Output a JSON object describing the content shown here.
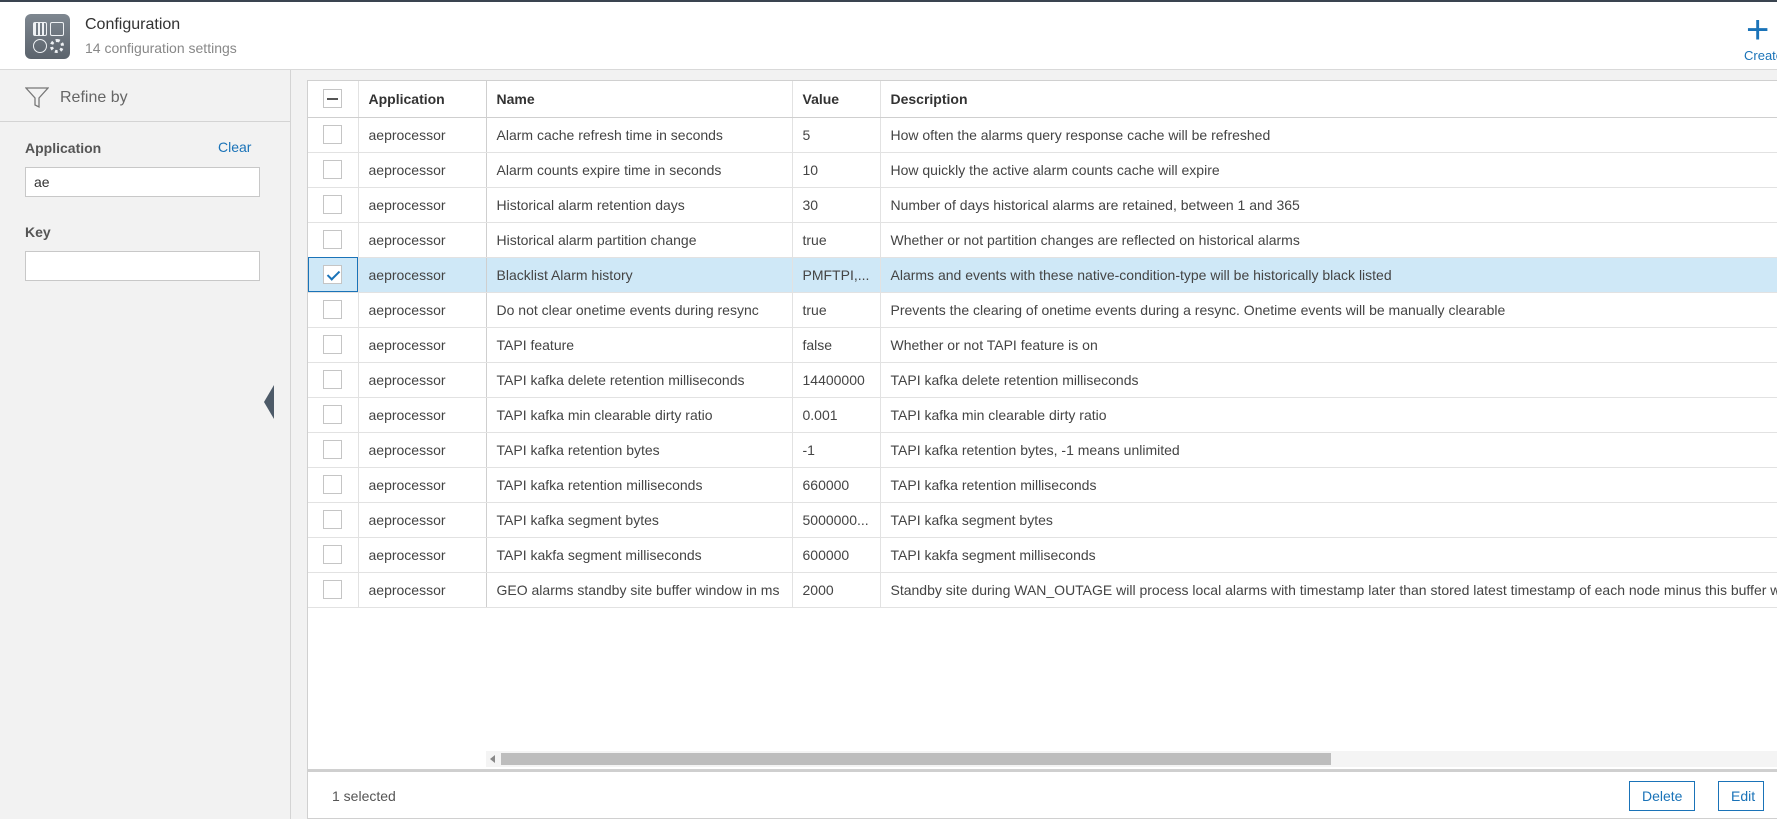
{
  "header": {
    "title": "Configuration",
    "subtitle": "14 configuration settings",
    "create_label": "Create"
  },
  "sidebar": {
    "refine_label": "Refine by",
    "application_label": "Application",
    "clear_label": "Clear",
    "application_value": "ae",
    "key_label": "Key",
    "key_value": ""
  },
  "table": {
    "columns": [
      "Application",
      "Name",
      "Value",
      "Description"
    ],
    "rows": [
      {
        "application": "aeprocessor",
        "name": "Alarm cache refresh time in seconds",
        "value": "5",
        "description": "How often the alarms query response cache will be refreshed",
        "selected": false
      },
      {
        "application": "aeprocessor",
        "name": "Alarm counts expire time in seconds",
        "value": "10",
        "description": "How quickly the active alarm counts cache will expire",
        "selected": false
      },
      {
        "application": "aeprocessor",
        "name": "Historical alarm retention days",
        "value": "30",
        "description": "Number of days historical alarms are retained, between 1 and 365",
        "selected": false
      },
      {
        "application": "aeprocessor",
        "name": "Historical alarm partition change",
        "value": "true",
        "description": "Whether or not partition changes are reflected on historical alarms",
        "selected": false
      },
      {
        "application": "aeprocessor",
        "name": "Blacklist Alarm history",
        "value": "PMFTPI,...",
        "description": "Alarms and events with these native-condition-type will be historically black listed",
        "selected": true
      },
      {
        "application": "aeprocessor",
        "name": "Do not clear onetime events during resync",
        "value": "true",
        "description": "Prevents the clearing of onetime events during a resync. Onetime events will be manually clearable",
        "selected": false
      },
      {
        "application": "aeprocessor",
        "name": "TAPI feature",
        "value": "false",
        "description": "Whether or not TAPI feature is on",
        "selected": false
      },
      {
        "application": "aeprocessor",
        "name": "TAPI kafka delete retention milliseconds",
        "value": "14400000",
        "description": "TAPI kafka delete retention milliseconds",
        "selected": false
      },
      {
        "application": "aeprocessor",
        "name": "TAPI kafka min clearable dirty ratio",
        "value": "0.001",
        "description": "TAPI kafka min clearable dirty ratio",
        "selected": false
      },
      {
        "application": "aeprocessor",
        "name": "TAPI kafka retention bytes",
        "value": "-1",
        "description": "TAPI kafka retention bytes, -1 means unlimited",
        "selected": false
      },
      {
        "application": "aeprocessor",
        "name": "TAPI kafka retention milliseconds",
        "value": "660000",
        "description": "TAPI kafka retention milliseconds",
        "selected": false
      },
      {
        "application": "aeprocessor",
        "name": "TAPI kafka segment bytes",
        "value": "5000000...",
        "description": "TAPI kafka segment bytes",
        "selected": false
      },
      {
        "application": "aeprocessor",
        "name": "TAPI kakfa segment milliseconds",
        "value": "600000",
        "description": "TAPI kakfa segment milliseconds",
        "selected": false
      },
      {
        "application": "aeprocessor",
        "name": "GEO alarms standby site buffer window in ms",
        "value": "2000",
        "description": "Standby site during WAN_OUTAGE will process local alarms with timestamp later than stored latest timestamp of each node minus this buffer window",
        "selected": false
      }
    ]
  },
  "footer": {
    "selected_text": "1 selected",
    "delete_label": "Delete",
    "edit_label": "Edit"
  },
  "colors": {
    "accent": "#1a73b8",
    "selected_row": "#cfe8f7"
  }
}
